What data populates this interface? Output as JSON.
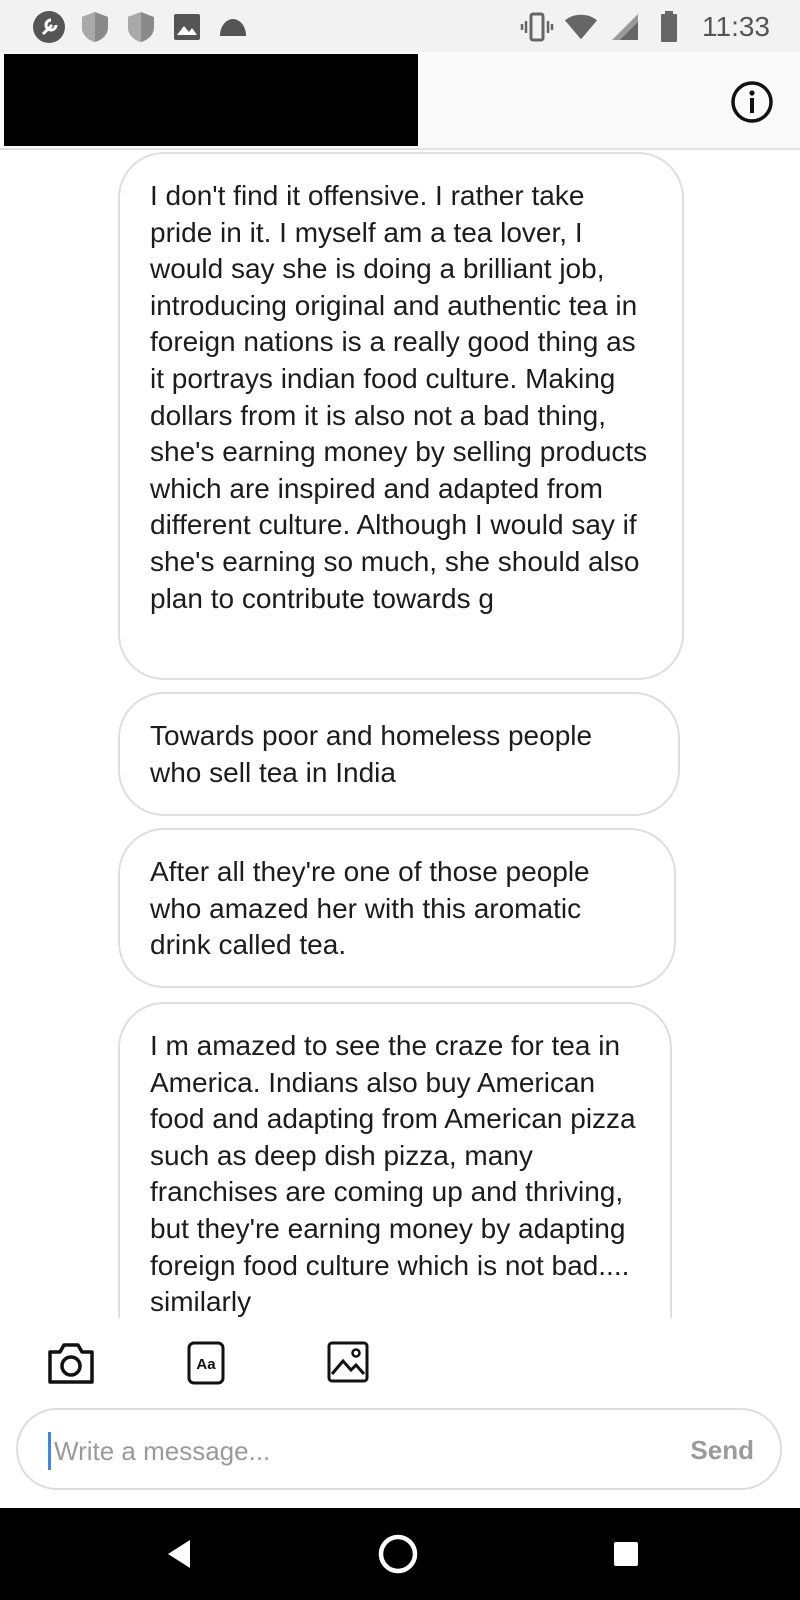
{
  "status_bar": {
    "time": "11:33",
    "left_icons": [
      "dev-tools-icon",
      "shield-icon",
      "shield-icon",
      "gallery-icon",
      "cloud-icon"
    ],
    "right_icons": [
      "vibrate-icon",
      "wifi-icon",
      "signal-icon",
      "battery-icon"
    ]
  },
  "header": {
    "title_redacted": true
  },
  "messages": [
    {
      "text": "I don't find it offensive. I rather take pride in it. I myself am a tea lover, I would say she is doing a brilliant job, introducing original and authentic tea in foreign nations is a really good thing as it portrays indian food culture. Making dollars from it is also not a bad thing, she's earning money by selling products which are inspired and adapted from different culture. Although I would say if she's earning so much, she should also plan to contribute towards g"
    },
    {
      "text": "Towards poor and homeless people who sell tea in India"
    },
    {
      "text": "After all they're one of those people who amazed her with this aromatic drink called tea."
    },
    {
      "text": "I m amazed to see the craze for tea in America. Indians also buy American food and adapting from American pizza such as deep dish pizza, many franchises are coming up and thriving, but they're earning money by adapting foreign food culture which is not bad.... similarly"
    }
  ],
  "compose": {
    "tools": [
      "camera-icon",
      "text-format-icon",
      "image-icon"
    ],
    "text_tool_label": "Aa",
    "placeholder": "Write a message...",
    "value": "",
    "send_label": "Send"
  },
  "colors": {
    "status_bar_bg": "#f2f2f2",
    "bubble_border": "#dedede",
    "caret": "#3f86e8",
    "send_disabled": "#9b9b9b",
    "nav_bar_bg": "#000000"
  }
}
